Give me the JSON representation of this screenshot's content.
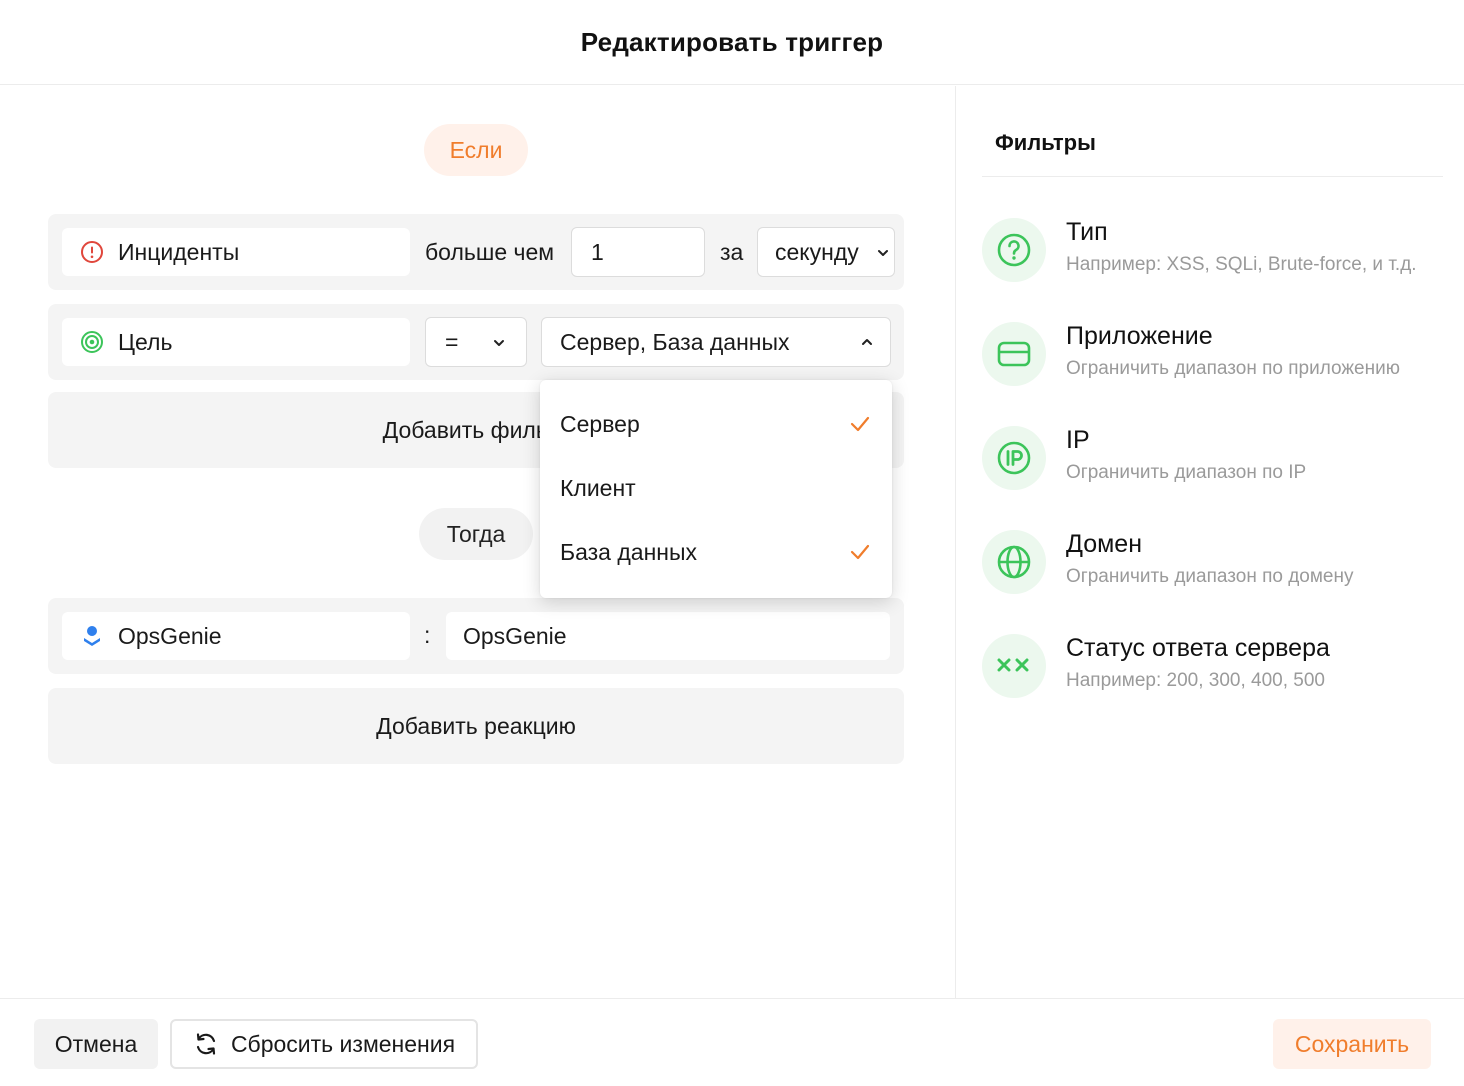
{
  "header": {
    "title": "Редактировать триггер"
  },
  "condition": {
    "if_label": "Если",
    "row1": {
      "event": "Инциденты",
      "comparator": "больше чем",
      "count": "1",
      "per_label": "за",
      "period": "секунду"
    },
    "row2": {
      "target_label": "Цель",
      "operator": "=",
      "value": "Сервер, База данных"
    },
    "add_filter": "Добавить фильтр"
  },
  "dropdown": {
    "options": [
      {
        "label": "Сервер",
        "checked": true
      },
      {
        "label": "Клиент",
        "checked": false
      },
      {
        "label": "База данных",
        "checked": true
      }
    ]
  },
  "action": {
    "then_label": "Тогда",
    "reaction_name": "OpsGenie",
    "separator": ":",
    "reaction_value": "OpsGenie",
    "add_reaction": "Добавить реакцию"
  },
  "filters": {
    "title": "Фильтры",
    "items": [
      {
        "title": "Тип",
        "desc": "Например: XSS, SQLi, Brute-force, и т.д.",
        "icon": "question-icon"
      },
      {
        "title": "Приложение",
        "desc": "Ограничить диапазон по приложению",
        "icon": "card-icon"
      },
      {
        "title": "IP",
        "desc": "Ограничить диапазон по IP",
        "icon": "ip-icon"
      },
      {
        "title": "Домен",
        "desc": "Ограничить диапазон по домену",
        "icon": "globe-icon"
      },
      {
        "title": "Статус ответа сервера",
        "desc": "Например: 200, 300, 400, 500",
        "icon": "xx-icon"
      }
    ]
  },
  "footer": {
    "cancel": "Отмена",
    "reset": "Сбросить изменения",
    "save": "Сохранить"
  },
  "colors": {
    "accent": "#f07d2c",
    "accent_bg": "#fff1ea",
    "green": "#3cc45a",
    "green_bg": "#ecf8ee",
    "error": "#e0473c",
    "blue": "#2f80ed"
  }
}
